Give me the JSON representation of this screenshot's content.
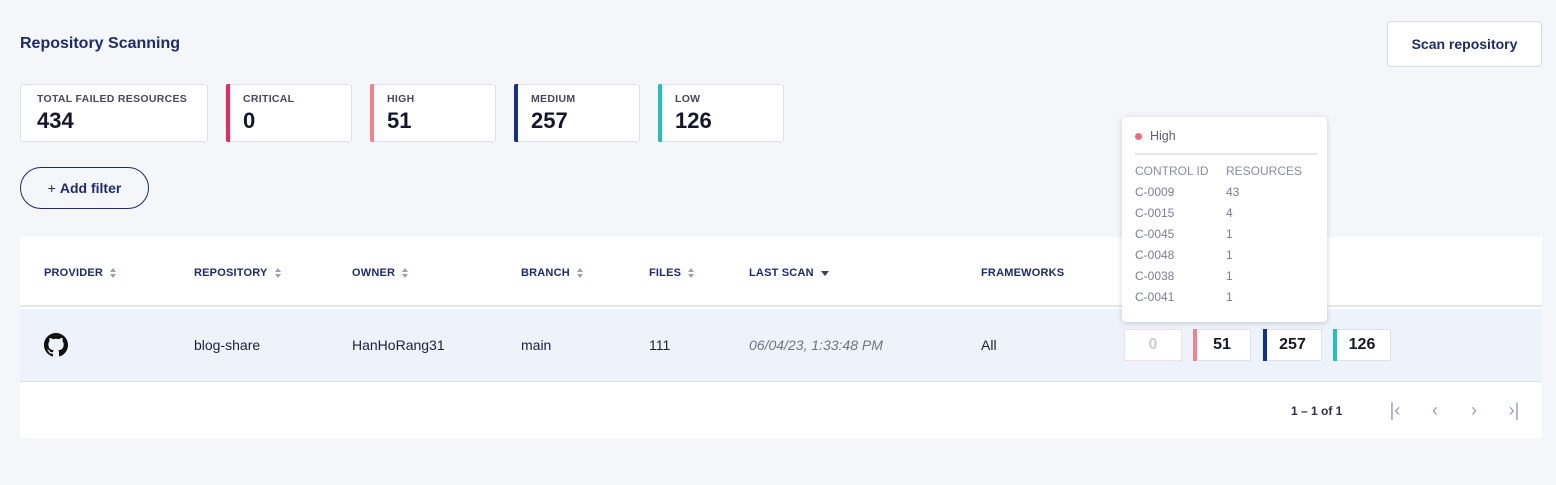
{
  "page": {
    "title": "Repository Scanning",
    "scan_button": "Scan repository",
    "add_filter": "Add filter",
    "add_filter_plus": "+"
  },
  "stats": [
    {
      "label": "TOTAL FAILED RESOURCES",
      "value": "434",
      "color": ""
    },
    {
      "label": "CRITICAL",
      "value": "0",
      "color": "#ee2560"
    },
    {
      "label": "HIGH",
      "value": "51",
      "color": "#f48089"
    },
    {
      "label": "MEDIUM",
      "value": "257",
      "color": "#14308a"
    },
    {
      "label": "LOW",
      "value": "126",
      "color": "#1fc1b8"
    }
  ],
  "table": {
    "columns": [
      "PROVIDER",
      "REPOSITORY",
      "OWNER",
      "BRANCH",
      "FILES",
      "LAST SCAN",
      "FRAMEWORKS"
    ],
    "rows": [
      {
        "provider_icon": "github-icon",
        "repository": "blog-share",
        "owner": "HanHoRang31",
        "branch": "main",
        "files": "111",
        "last_scan": "06/04/23, 1:33:48 PM",
        "frameworks": "All",
        "severities": {
          "critical": "0",
          "high": "51",
          "medium": "257",
          "low": "126"
        }
      }
    ]
  },
  "pagination": {
    "text": "1 – 1 of 1",
    "first_icon": "first-page-icon",
    "prev_icon": "chevron-left-icon",
    "next_icon": "chevron-right-icon",
    "last_icon": "last-page-icon"
  },
  "tooltip": {
    "severity": "High",
    "dot_color": "#f06b7c",
    "col_control": "CONTROL ID",
    "col_resources": "RESOURCES",
    "items": [
      {
        "control": "C-0009",
        "resources": "43"
      },
      {
        "control": "C-0015",
        "resources": "4"
      },
      {
        "control": "C-0045",
        "resources": "1"
      },
      {
        "control": "C-0048",
        "resources": "1"
      },
      {
        "control": "C-0038",
        "resources": "1"
      },
      {
        "control": "C-0041",
        "resources": "1"
      }
    ]
  }
}
